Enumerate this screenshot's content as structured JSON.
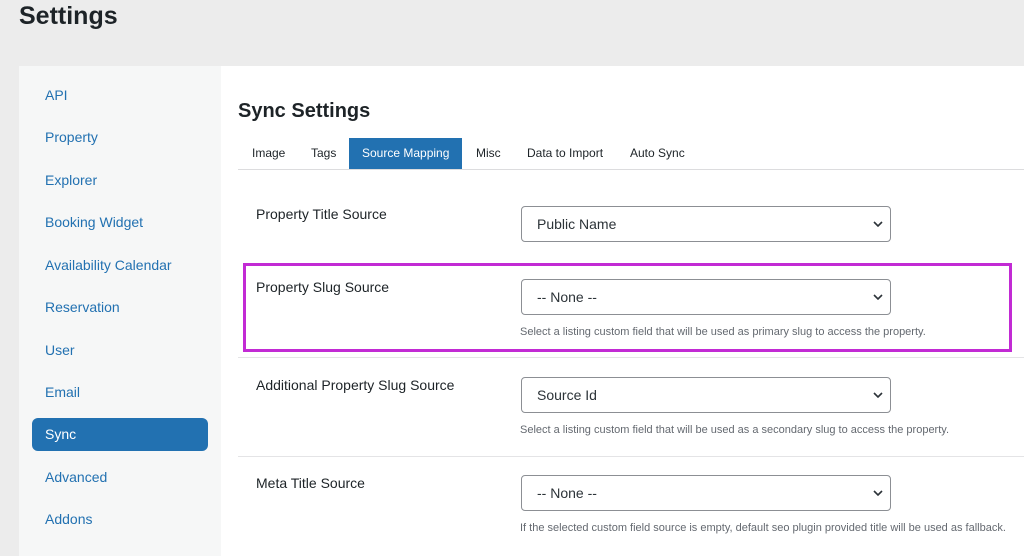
{
  "page": {
    "title": "Settings"
  },
  "sidebar": {
    "items": [
      {
        "label": "API"
      },
      {
        "label": "Property"
      },
      {
        "label": "Explorer"
      },
      {
        "label": "Booking Widget"
      },
      {
        "label": "Availability Calendar"
      },
      {
        "label": "Reservation"
      },
      {
        "label": "User"
      },
      {
        "label": "Email"
      },
      {
        "label": "Sync",
        "active": true
      },
      {
        "label": "Advanced"
      },
      {
        "label": "Addons"
      }
    ]
  },
  "main": {
    "title": "Sync Settings",
    "tabs": [
      {
        "label": "Image"
      },
      {
        "label": "Tags"
      },
      {
        "label": "Source Mapping",
        "active": true
      },
      {
        "label": "Misc"
      },
      {
        "label": "Data to Import"
      },
      {
        "label": "Auto Sync"
      }
    ],
    "fields": [
      {
        "label": "Property Title Source",
        "value": "Public Name",
        "help": ""
      },
      {
        "label": "Property Slug Source",
        "value": "-- None --",
        "help": "Select a listing custom field that will be used as primary slug to access the property."
      },
      {
        "label": "Additional Property Slug Source",
        "value": "Source Id",
        "help": "Select a listing custom field that will be used as a secondary slug to access the property."
      },
      {
        "label": "Meta Title Source",
        "value": "-- None --",
        "help": "If the selected custom field source is empty, default seo plugin provided title will be used as fallback."
      }
    ]
  },
  "colors": {
    "accent": "#2271b1",
    "highlight": "#c22ad4"
  },
  "icons": {
    "select_indicator": "chevron-down-icon"
  }
}
